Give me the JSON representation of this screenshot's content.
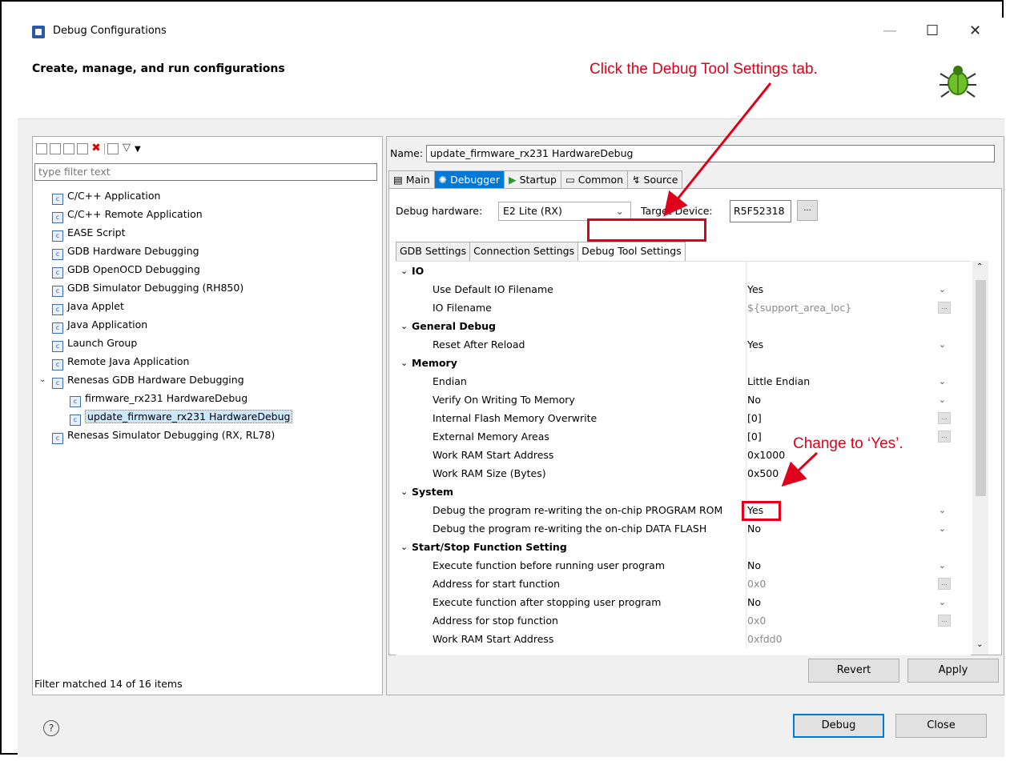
{
  "window": {
    "title": "Debug Configurations",
    "header_title": "Create, manage, and run configurations"
  },
  "annotations": {
    "top": "Click the Debug Tool Settings tab.",
    "middle": "Change to ‘Yes’."
  },
  "left": {
    "filter_placeholder": "type filter text",
    "tree": [
      {
        "label": "C/C++ Application",
        "icon": "c-app-icon",
        "level": 0
      },
      {
        "label": "C/C++ Remote Application",
        "icon": "c-remote-icon",
        "level": 0
      },
      {
        "label": "EASE Script",
        "icon": "script-icon",
        "level": 0
      },
      {
        "label": "GDB Hardware Debugging",
        "icon": "c-app-icon",
        "level": 0
      },
      {
        "label": "GDB OpenOCD Debugging",
        "icon": "c-app-icon",
        "level": 0
      },
      {
        "label": "GDB Simulator Debugging (RH850)",
        "icon": "c-app-icon",
        "level": 0
      },
      {
        "label": "Java Applet",
        "icon": "java-applet-icon",
        "level": 0
      },
      {
        "label": "Java Application",
        "icon": "java-app-icon",
        "level": 0
      },
      {
        "label": "Launch Group",
        "icon": "launch-group-icon",
        "level": 0
      },
      {
        "label": "Remote Java Application",
        "icon": "remote-java-icon",
        "level": 0
      },
      {
        "label": "Renesas GDB Hardware Debugging",
        "icon": "c-app-icon",
        "level": 0
      },
      {
        "label": "firmware_rx231 HardwareDebug",
        "icon": "c-app-icon",
        "level": 1
      },
      {
        "label": "update_firmware_rx231 HardwareDebug",
        "icon": "c-app-icon",
        "level": 1
      },
      {
        "label": "Renesas Simulator Debugging (RX, RL78)",
        "icon": "c-app-icon",
        "level": 0
      }
    ],
    "filter_status": "Filter matched 14 of 16 items"
  },
  "right": {
    "name_label": "Name:",
    "name_value": "update_firmware_rx231 HardwareDebug",
    "tabs": [
      "Main",
      "Debugger",
      "Startup",
      "Common",
      "Source"
    ],
    "debug_hw_label": "Debug hardware:",
    "debug_hw_value": "E2 Lite (RX)",
    "target_label": "Target Device:",
    "target_value": "R5F52318",
    "browse_label": "...",
    "subtabs": [
      "GDB Settings",
      "Connection Settings",
      "Debug Tool Settings"
    ],
    "rows": [
      {
        "key": "IO",
        "cat": true
      },
      {
        "key": "Use Default IO Filename",
        "val": "Yes",
        "type": "dd"
      },
      {
        "key": "IO Filename",
        "val": "${support_area_loc}",
        "type": "dots",
        "dim": true
      },
      {
        "key": "General Debug",
        "cat": true
      },
      {
        "key": "Reset After Reload",
        "val": "Yes",
        "type": "dd"
      },
      {
        "key": "Memory",
        "cat": true
      },
      {
        "key": "Endian",
        "val": "Little Endian",
        "type": "dd"
      },
      {
        "key": "Verify On Writing To Memory",
        "val": "No",
        "type": "dd"
      },
      {
        "key": "Internal Flash Memory Overwrite",
        "val": "[0]",
        "type": "dots"
      },
      {
        "key": "External Memory Areas",
        "val": "[0]",
        "type": "dots"
      },
      {
        "key": "Work RAM Start Address",
        "val": "0x1000"
      },
      {
        "key": "Work RAM Size (Bytes)",
        "val": "0x500"
      },
      {
        "key": "System",
        "cat": true
      },
      {
        "key": "Debug the program re-writing the on-chip PROGRAM ROM",
        "val": "Yes",
        "type": "dd"
      },
      {
        "key": "Debug the program re-writing the on-chip DATA FLASH",
        "val": "No",
        "type": "dd"
      },
      {
        "key": "Start/Stop Function Setting",
        "cat": true
      },
      {
        "key": "Execute function before running user program",
        "val": "No",
        "type": "dd"
      },
      {
        "key": "Address for start function",
        "val": "0x0",
        "type": "dots",
        "dim": true
      },
      {
        "key": "Execute function after stopping user program",
        "val": "No",
        "type": "dd"
      },
      {
        "key": "Address for stop function",
        "val": "0x0",
        "type": "dots",
        "dim": true
      },
      {
        "key": "Work RAM Start Address",
        "val": "0xfdd0",
        "dim": true
      }
    ],
    "revert": "Revert",
    "apply": "Apply"
  },
  "footer": {
    "debug": "Debug",
    "close": "Close",
    "help": "?"
  }
}
